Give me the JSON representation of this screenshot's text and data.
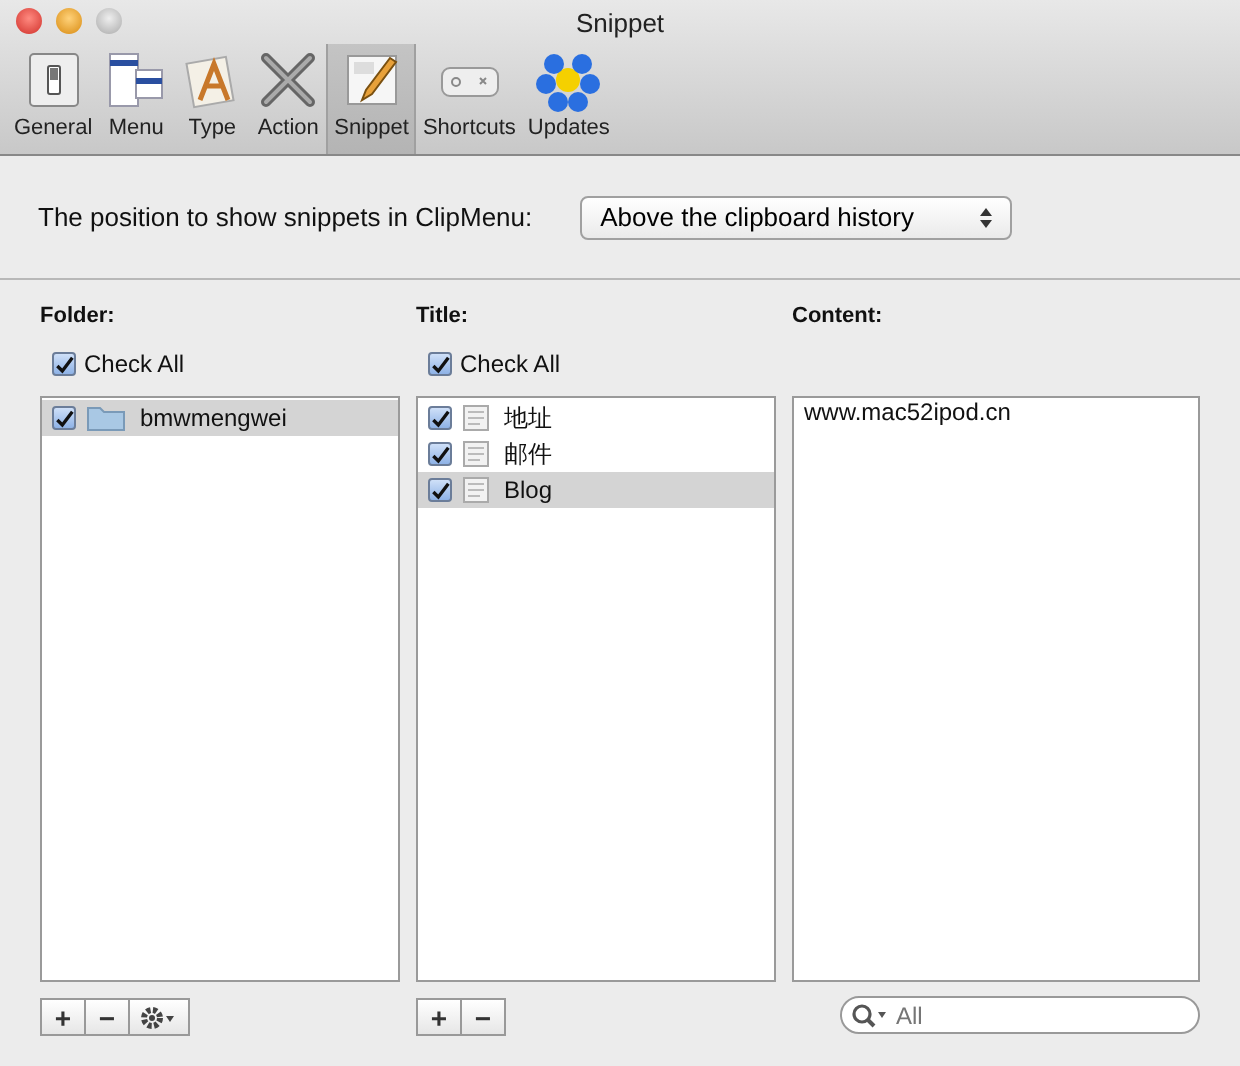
{
  "window": {
    "title": "Snippet"
  },
  "toolbar": [
    {
      "label": "General",
      "selected": false
    },
    {
      "label": "Menu",
      "selected": false
    },
    {
      "label": "Type",
      "selected": false
    },
    {
      "label": "Action",
      "selected": false
    },
    {
      "label": "Snippet",
      "selected": true
    },
    {
      "label": "Shortcuts",
      "selected": false
    },
    {
      "label": "Updates",
      "selected": false
    }
  ],
  "position": {
    "label": "The position to show snippets in ClipMenu:",
    "value": "Above the clipboard history"
  },
  "folders": {
    "heading": "Folder:",
    "check_all": {
      "label": "Check All",
      "checked": true
    },
    "items": [
      {
        "name": "bmwmengwei",
        "checked": true,
        "selected": true
      }
    ],
    "buttons": [
      "+",
      "−"
    ]
  },
  "titles": {
    "heading": "Title:",
    "check_all": {
      "label": "Check All",
      "checked": true
    },
    "items": [
      {
        "name": "地址",
        "checked": true,
        "selected": false
      },
      {
        "name": "邮件",
        "checked": true,
        "selected": false
      },
      {
        "name": "Blog",
        "checked": true,
        "selected": true
      }
    ],
    "buttons": [
      "+",
      "−"
    ]
  },
  "content": {
    "heading": "Content:",
    "text": "www.mac52ipod.cn"
  },
  "search": {
    "placeholder": "All"
  }
}
